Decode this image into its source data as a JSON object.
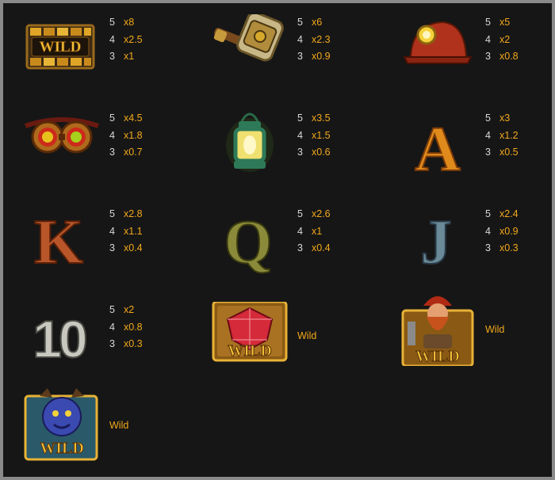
{
  "symbols": [
    {
      "id": "wild-chest",
      "pays": [
        {
          "count": "5",
          "mult": "x8"
        },
        {
          "count": "4",
          "mult": "x2.5"
        },
        {
          "count": "3",
          "mult": "x1"
        }
      ],
      "icon_text": "WILD",
      "icon": "wild-gold-bars-icon"
    },
    {
      "id": "hammer",
      "pays": [
        {
          "count": "5",
          "mult": "x6"
        },
        {
          "count": "4",
          "mult": "x2.3"
        },
        {
          "count": "3",
          "mult": "x0.9"
        }
      ],
      "icon": "hammer-icon"
    },
    {
      "id": "helmet",
      "pays": [
        {
          "count": "5",
          "mult": "x5"
        },
        {
          "count": "4",
          "mult": "x2"
        },
        {
          "count": "3",
          "mult": "x0.8"
        }
      ],
      "icon": "miner-helmet-icon"
    },
    {
      "id": "goggles",
      "pays": [
        {
          "count": "5",
          "mult": "x4.5"
        },
        {
          "count": "4",
          "mult": "x1.8"
        },
        {
          "count": "3",
          "mult": "x0.7"
        }
      ],
      "icon": "goggles-icon"
    },
    {
      "id": "lantern",
      "pays": [
        {
          "count": "5",
          "mult": "x3.5"
        },
        {
          "count": "4",
          "mult": "x1.5"
        },
        {
          "count": "3",
          "mult": "x0.6"
        }
      ],
      "icon": "lantern-icon"
    },
    {
      "id": "letter-a",
      "pays": [
        {
          "count": "5",
          "mult": "x3"
        },
        {
          "count": "4",
          "mult": "x1.2"
        },
        {
          "count": "3",
          "mult": "x0.5"
        }
      ],
      "icon": "letter-a-icon",
      "glyph": "A"
    },
    {
      "id": "letter-k",
      "pays": [
        {
          "count": "5",
          "mult": "x2.8"
        },
        {
          "count": "4",
          "mult": "x1.1"
        },
        {
          "count": "3",
          "mult": "x0.4"
        }
      ],
      "icon": "letter-k-icon",
      "glyph": "K"
    },
    {
      "id": "letter-q",
      "pays": [
        {
          "count": "5",
          "mult": "x2.6"
        },
        {
          "count": "4",
          "mult": "x1"
        },
        {
          "count": "3",
          "mult": "x0.4"
        }
      ],
      "icon": "letter-q-icon",
      "glyph": "Q"
    },
    {
      "id": "letter-j",
      "pays": [
        {
          "count": "5",
          "mult": "x2.4"
        },
        {
          "count": "4",
          "mult": "x0.9"
        },
        {
          "count": "3",
          "mult": "x0.3"
        }
      ],
      "icon": "letter-j-icon",
      "glyph": "J"
    },
    {
      "id": "number-10",
      "pays": [
        {
          "count": "5",
          "mult": "x2"
        },
        {
          "count": "4",
          "mult": "x0.8"
        },
        {
          "count": "3",
          "mult": "x0.3"
        }
      ],
      "icon": "number-10-icon",
      "glyph": "10"
    }
  ],
  "wilds": [
    {
      "id": "wild-gem",
      "label": "Wild",
      "icon_text": "WILD",
      "icon": "wild-ruby-icon"
    },
    {
      "id": "wild-dwarf",
      "label": "Wild",
      "icon_text": "WILD",
      "icon": "wild-dwarf-icon"
    },
    {
      "id": "wild-goblin",
      "label": "Wild",
      "icon_text": "WILD",
      "icon": "wild-goblin-icon"
    }
  ],
  "colors": {
    "background": "#161616",
    "frame": "#8a8a8a",
    "multiplier": "#f2a81c",
    "count": "#d8d8d8"
  }
}
